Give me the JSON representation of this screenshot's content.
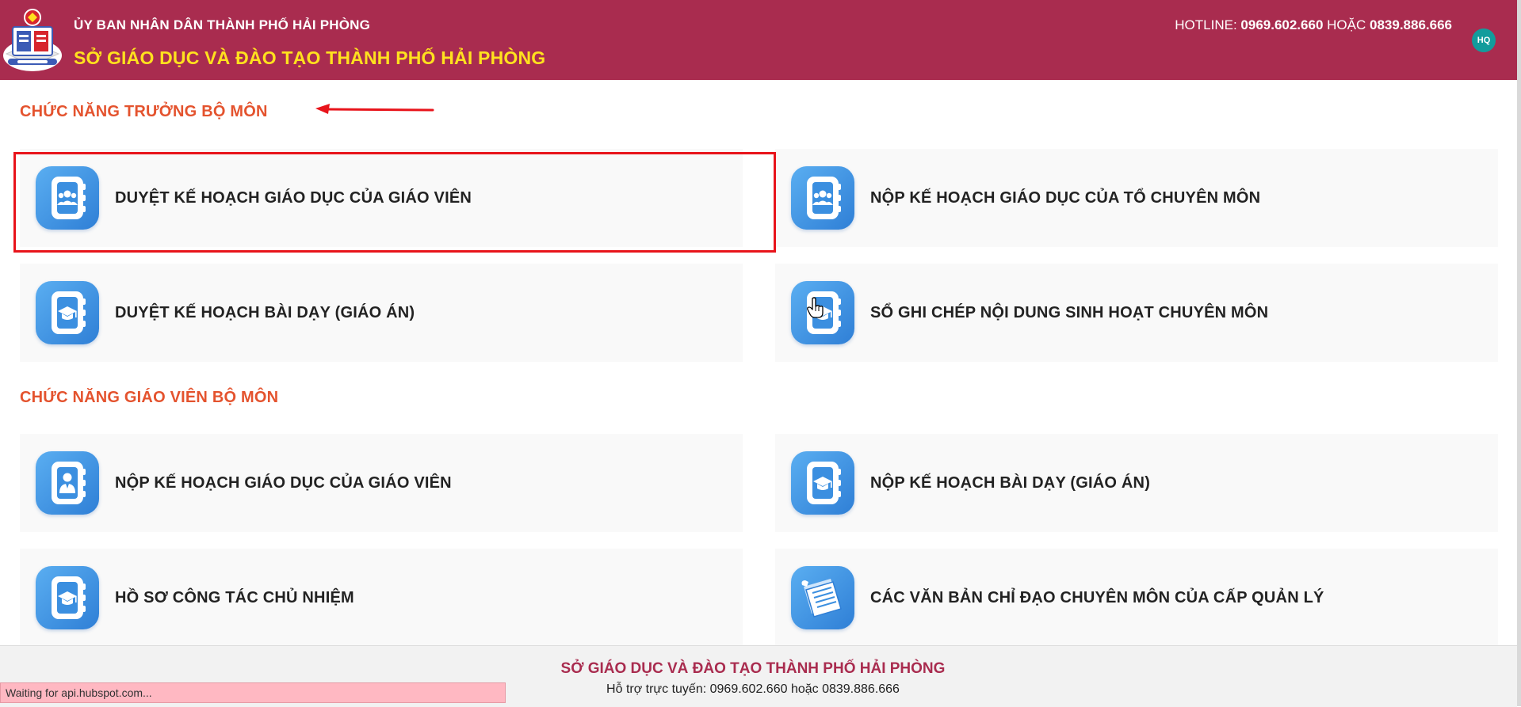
{
  "header": {
    "gov_name": "ỦY BAN NHÂN DÂN THÀNH PHỐ HẢI PHÒNG",
    "dept_name": "SỞ GIÁO DỤC VÀ ĐÀO TẠO THÀNH PHỐ HẢI PHÒNG",
    "hotline_label": "HOTLINE:",
    "hotline_1": "0969.602.660",
    "hotline_or": "HOẶC",
    "hotline_2": "0839.886.666",
    "avatar_initials": "HQ"
  },
  "sections": [
    {
      "title": "CHỨC NĂNG TRƯỞNG BỘ MÔN",
      "cards": [
        {
          "label": "DUYỆT KẾ HOẠCH GIÁO DỤC CỦA GIÁO VIÊN",
          "icon": "group-book-icon"
        },
        {
          "label": "NỘP KẾ HOẠCH GIÁO DỤC CỦA TỔ CHUYÊN MÔN",
          "icon": "group-book-icon"
        },
        {
          "label": "DUYỆT KẾ HOẠCH BÀI DẠY (GIÁO ÁN)",
          "icon": "graduation-book-icon"
        },
        {
          "label": "SỔ GHI CHÉP NỘI DUNG SINH HOẠT CHUYÊN MÔN",
          "icon": "graduation-book-icon"
        }
      ]
    },
    {
      "title": "CHỨC NĂNG GIÁO VIÊN BỘ MÔN",
      "cards": [
        {
          "label": "NỘP KẾ HOẠCH GIÁO DỤC CỦA GIÁO VIÊN",
          "icon": "teacher-book-icon"
        },
        {
          "label": "NỘP KẾ HOẠCH BÀI DẠY (GIÁO ÁN)",
          "icon": "graduation-book-icon"
        },
        {
          "label": "HỒ SƠ CÔNG TÁC CHỦ NHIỆM",
          "icon": "graduation-book-icon"
        },
        {
          "label": "CÁC VĂN BẢN CHỈ ĐẠO CHUYÊN MÔN CỦA CẤP QUẢN LÝ",
          "icon": "documents-icon"
        }
      ]
    }
  ],
  "footer": {
    "title": "SỞ GIÁO DỤC VÀ ĐÀO TẠO THÀNH PHỐ HẢI PHÒNG",
    "support": "Hỗ trợ trực tuyến: 0969.602.660 hoặc 0839.886.666"
  },
  "status_bar": {
    "text": "Waiting for api.hubspot.com..."
  },
  "colors": {
    "header_bg": "#a92c4f",
    "dept_name": "#ffe11e",
    "section_title": "#e4532e",
    "highlight": "#e8141b",
    "icon_blue": "#3b8fe0",
    "avatar_bg": "#139c9c"
  }
}
